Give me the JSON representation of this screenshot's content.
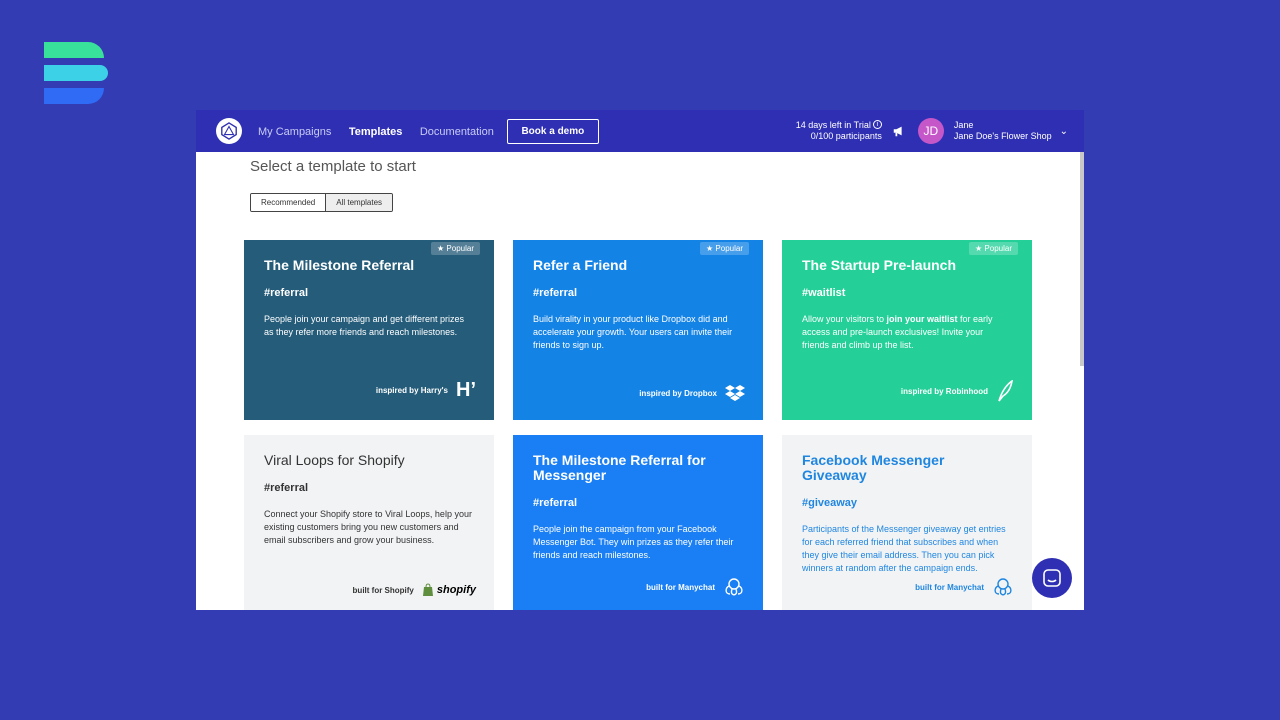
{
  "nav": {
    "my_campaigns": "My Campaigns",
    "templates": "Templates",
    "documentation": "Documentation",
    "book_demo": "Book a demo"
  },
  "trial": {
    "line1": "14 days left in Trial",
    "line2": "0/100 participants"
  },
  "user": {
    "initials": "JD",
    "name": "Jane",
    "shop": "Jane Doe's Flower Shop"
  },
  "page": {
    "heading": "Select a template to start",
    "toggle_recommended": "Recommended",
    "toggle_all": "All templates"
  },
  "cards": [
    {
      "title": "The Milestone Referral",
      "tag": "#referral",
      "desc": "People join your campaign and get different prizes as they refer more friends and reach milestones.",
      "badge": "Popular",
      "footer": "inspired by Harry's",
      "brand_mark": "H’"
    },
    {
      "title": "Refer a Friend",
      "tag": "#referral",
      "desc": "Build virality in your product like Dropbox did and accelerate your growth. Your users can invite their friends to sign up.",
      "badge": "Popular",
      "footer": "inspired by Dropbox"
    },
    {
      "title": "The Startup Pre-launch",
      "tag": "#waitlist",
      "desc_pre": "Allow your visitors to ",
      "desc_bold": "join your waitlist",
      "desc_post": " for early access and pre-launch exclusives! Invite your friends and climb up the list.",
      "badge": "Popular",
      "footer": "inspired by Robinhood"
    },
    {
      "title": "Viral Loops for Shopify",
      "tag": "#referral",
      "desc": "Connect your Shopify store to Viral Loops, help your existing customers bring you new customers and email subscribers and grow your business.",
      "footer": "built for Shopify",
      "brand_mark": "shopify"
    },
    {
      "title": "The Milestone Referral for Messenger",
      "tag": "#referral",
      "desc": "People join the campaign from your Facebook Messenger Bot. They win prizes as they refer their friends and reach milestones.",
      "footer": "built for Manychat"
    },
    {
      "title": "Facebook Messenger Giveaway",
      "tag": "#giveaway",
      "desc": "Participants of the Messenger giveaway get entries for each referred friend that subscribes and when they give their email address. Then you can pick winners at random after the campaign ends.",
      "footer": "built for Manychat"
    }
  ],
  "colors": {
    "background": "#343cb4",
    "topbar": "#2f2fb3",
    "card_milestone": "#245c7a",
    "card_refer": "#1483e6",
    "card_startup": "#25d098",
    "card_messenger": "#1a7ff5",
    "card_light": "#f2f3f5",
    "accent_blue": "#1f86e0"
  }
}
